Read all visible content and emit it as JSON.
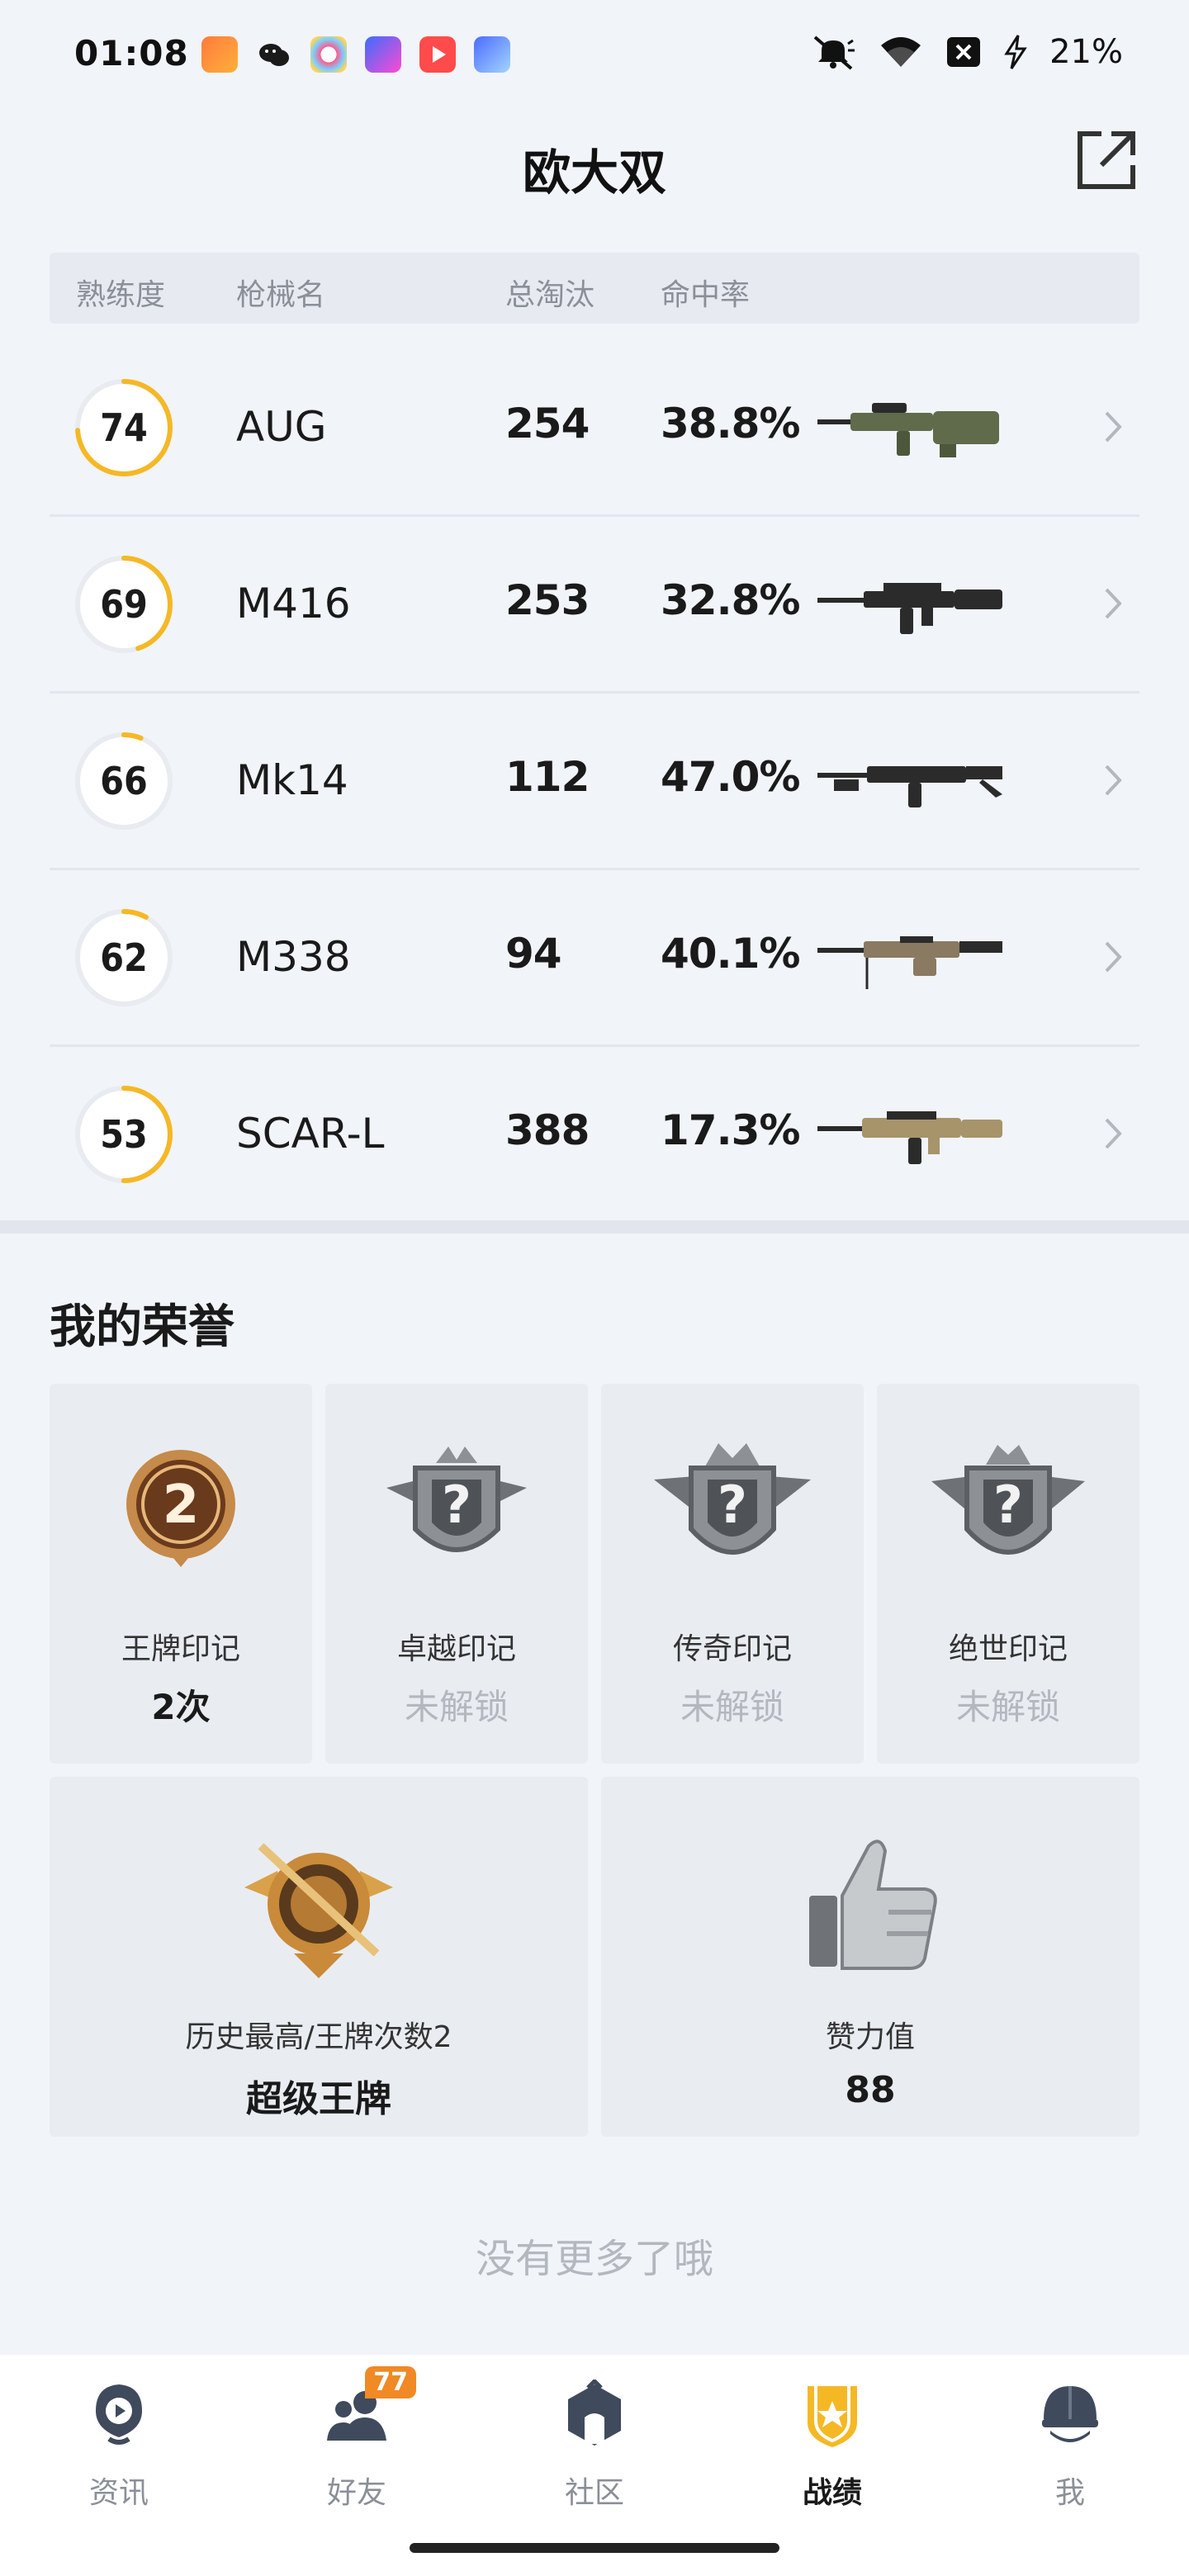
{
  "status_bar": {
    "time": "01:08",
    "battery": "21%",
    "app_icons": [
      "app-1-icon",
      "wechat-icon",
      "app-3-icon",
      "app-4-icon",
      "video-icon",
      "game-icon"
    ],
    "icons": [
      "mute-icon",
      "wifi-icon",
      "sim-off-icon",
      "charging-icon"
    ]
  },
  "header": {
    "title": "欧大双",
    "share_icon": "share-icon"
  },
  "table": {
    "columns": [
      "熟练度",
      "枪械名",
      "总淘汰",
      "命中率"
    ],
    "rows": [
      {
        "proficiency": "74",
        "name": "AUG",
        "eliminations": "254",
        "accuracy": "38.8%",
        "ring": 0.74,
        "color": "#5f6b4a"
      },
      {
        "proficiency": "69",
        "name": "M416",
        "eliminations": "253",
        "accuracy": "32.8%",
        "ring": 0.45,
        "color": "#2b2b2b"
      },
      {
        "proficiency": "66",
        "name": "Mk14",
        "eliminations": "112",
        "accuracy": "47.0%",
        "ring": 0.06,
        "color": "#2b2b2b"
      },
      {
        "proficiency": "62",
        "name": "M338",
        "eliminations": "94",
        "accuracy": "40.1%",
        "ring": 0.08,
        "color": "#8a7a62"
      },
      {
        "proficiency": "53",
        "name": "SCAR-L",
        "eliminations": "388",
        "accuracy": "17.3%",
        "ring": 0.5,
        "color": "#a8946a"
      }
    ],
    "ring_color": "#f5b825",
    "ring_track": "#e8ebf0"
  },
  "honor": {
    "title": "我的荣誉",
    "cards": [
      {
        "name": "王牌印记",
        "value": "2次",
        "locked": false,
        "badge_number": "2"
      },
      {
        "name": "卓越印记",
        "value": "未解锁",
        "locked": true,
        "badge_number": "?"
      },
      {
        "name": "传奇印记",
        "value": "未解锁",
        "locked": true,
        "badge_number": "?"
      },
      {
        "name": "绝世印记",
        "value": "未解锁",
        "locked": true,
        "badge_number": "?"
      }
    ],
    "wide": [
      {
        "label": "历史最高/王牌次数2",
        "value": "超级王牌"
      },
      {
        "label": "赞力值",
        "value": "88"
      }
    ]
  },
  "footer_text": "没有更多了哦",
  "nav": {
    "items": [
      {
        "label": "资讯",
        "icon": "news-icon",
        "active": false
      },
      {
        "label": "好友",
        "icon": "friends-icon",
        "active": false,
        "badge": "77"
      },
      {
        "label": "社区",
        "icon": "community-icon",
        "active": false
      },
      {
        "label": "战绩",
        "icon": "record-icon",
        "active": true
      },
      {
        "label": "我",
        "icon": "profile-icon",
        "active": false
      }
    ]
  },
  "colors": {
    "accent": "#f5b825",
    "background": "#f1f4f9",
    "muted": "#8a8f98",
    "badge": "#f08a24"
  }
}
